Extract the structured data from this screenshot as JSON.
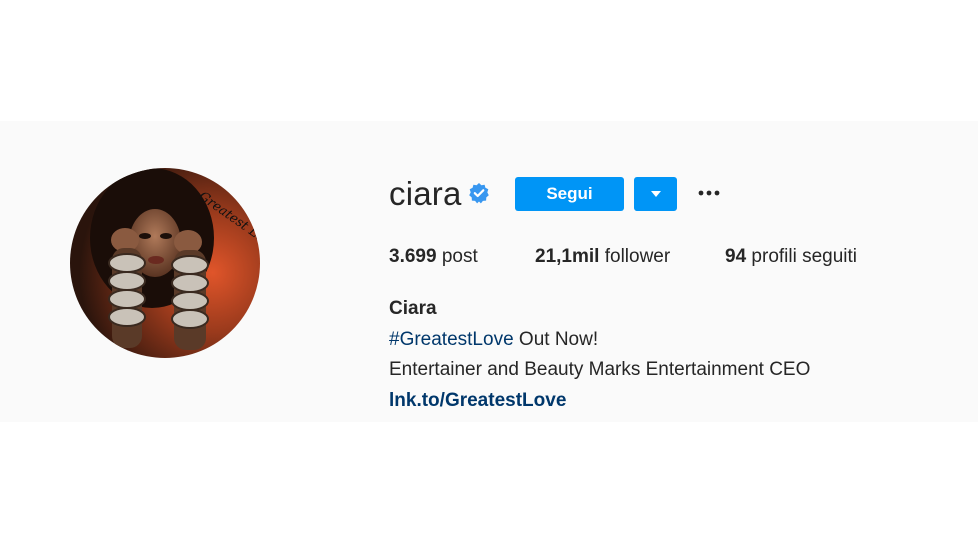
{
  "profile": {
    "username": "ciara",
    "follow_label": "Segui",
    "icons": {
      "verified": "verified-badge-icon",
      "dropdown": "caret-down-icon",
      "more": "ellipsis-icon"
    },
    "avatar_signature": "Greatest Love",
    "colors": {
      "accent": "#0095f6",
      "link": "#00376b",
      "text": "#262626"
    }
  },
  "stats": {
    "posts_count": "3.699",
    "posts_label": "post",
    "followers_count": "21,1mil",
    "followers_label": "follower",
    "following_count": "94",
    "following_label": "profili seguiti"
  },
  "bio": {
    "full_name": "Ciara",
    "line1_hashtag": "#GreatestLove",
    "line1_rest": " Out Now!",
    "line2": "Entertainer and Beauty Marks Entertainment CEO",
    "link": "lnk.to/GreatestLove"
  }
}
